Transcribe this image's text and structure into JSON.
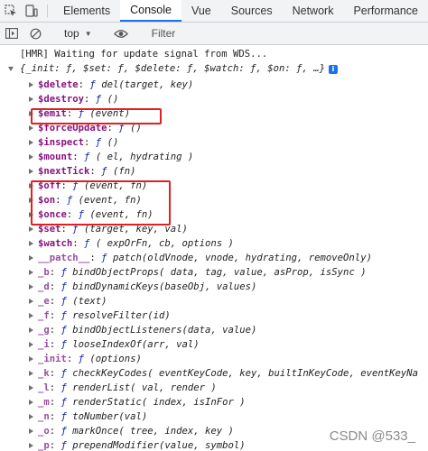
{
  "tabs": [
    "Elements",
    "Console",
    "Vue",
    "Sources",
    "Network",
    "Performance"
  ],
  "active_tab": "Console",
  "toolbar": {
    "context": "top",
    "filter_placeholder": "Filter"
  },
  "console": {
    "log_message": "[HMR] Waiting for update signal from WDS...",
    "object_summary": "{_init: ƒ, $set: ƒ, $delete: ƒ, $watch: ƒ, $on: ƒ, …}",
    "info_badge": "i",
    "properties": [
      {
        "key": "$delete",
        "sig": "del(target, key)"
      },
      {
        "key": "$destroy",
        "sig": "()"
      },
      {
        "key": "$emit",
        "sig": "(event)",
        "highlight": true
      },
      {
        "key": "$forceUpdate",
        "sig": "()"
      },
      {
        "key": "$inspect",
        "sig": "()"
      },
      {
        "key": "$mount",
        "sig": "( el, hydrating )"
      },
      {
        "key": "$nextTick",
        "sig": "(fn)"
      },
      {
        "key": "$off",
        "sig": "(event, fn)",
        "highlight": true
      },
      {
        "key": "$on",
        "sig": "(event, fn)",
        "highlight": true
      },
      {
        "key": "$once",
        "sig": "(event, fn)",
        "highlight": true
      },
      {
        "key": "$set",
        "sig": "(target, key, val)"
      },
      {
        "key": "$watch",
        "sig": "( expOrFn, cb, options )"
      },
      {
        "key": "__patch__",
        "sig": "patch(oldVnode, vnode, hydrating, removeOnly)"
      },
      {
        "key": "_b",
        "sig": "bindObjectProps( data, tag, value, asProp, isSync )"
      },
      {
        "key": "_d",
        "sig": "bindDynamicKeys(baseObj, values)"
      },
      {
        "key": "_e",
        "sig": "(text)"
      },
      {
        "key": "_f",
        "sig": "resolveFilter(id)"
      },
      {
        "key": "_g",
        "sig": "bindObjectListeners(data, value)"
      },
      {
        "key": "_i",
        "sig": "looseIndexOf(arr, val)"
      },
      {
        "key": "_init",
        "sig": "(options)"
      },
      {
        "key": "_k",
        "sig": "checkKeyCodes( eventKeyCode, key, builtInKeyCode, eventKeyNa"
      },
      {
        "key": "_l",
        "sig": "renderList( val, render )"
      },
      {
        "key": "_m",
        "sig": "renderStatic( index, isInFor )"
      },
      {
        "key": "_n",
        "sig": "toNumber(val)"
      },
      {
        "key": "_o",
        "sig": "markOnce( tree, index, key )"
      },
      {
        "key": "_p",
        "sig": "prependModifier(value, symbol)"
      }
    ]
  },
  "watermark": "CSDN @533_"
}
